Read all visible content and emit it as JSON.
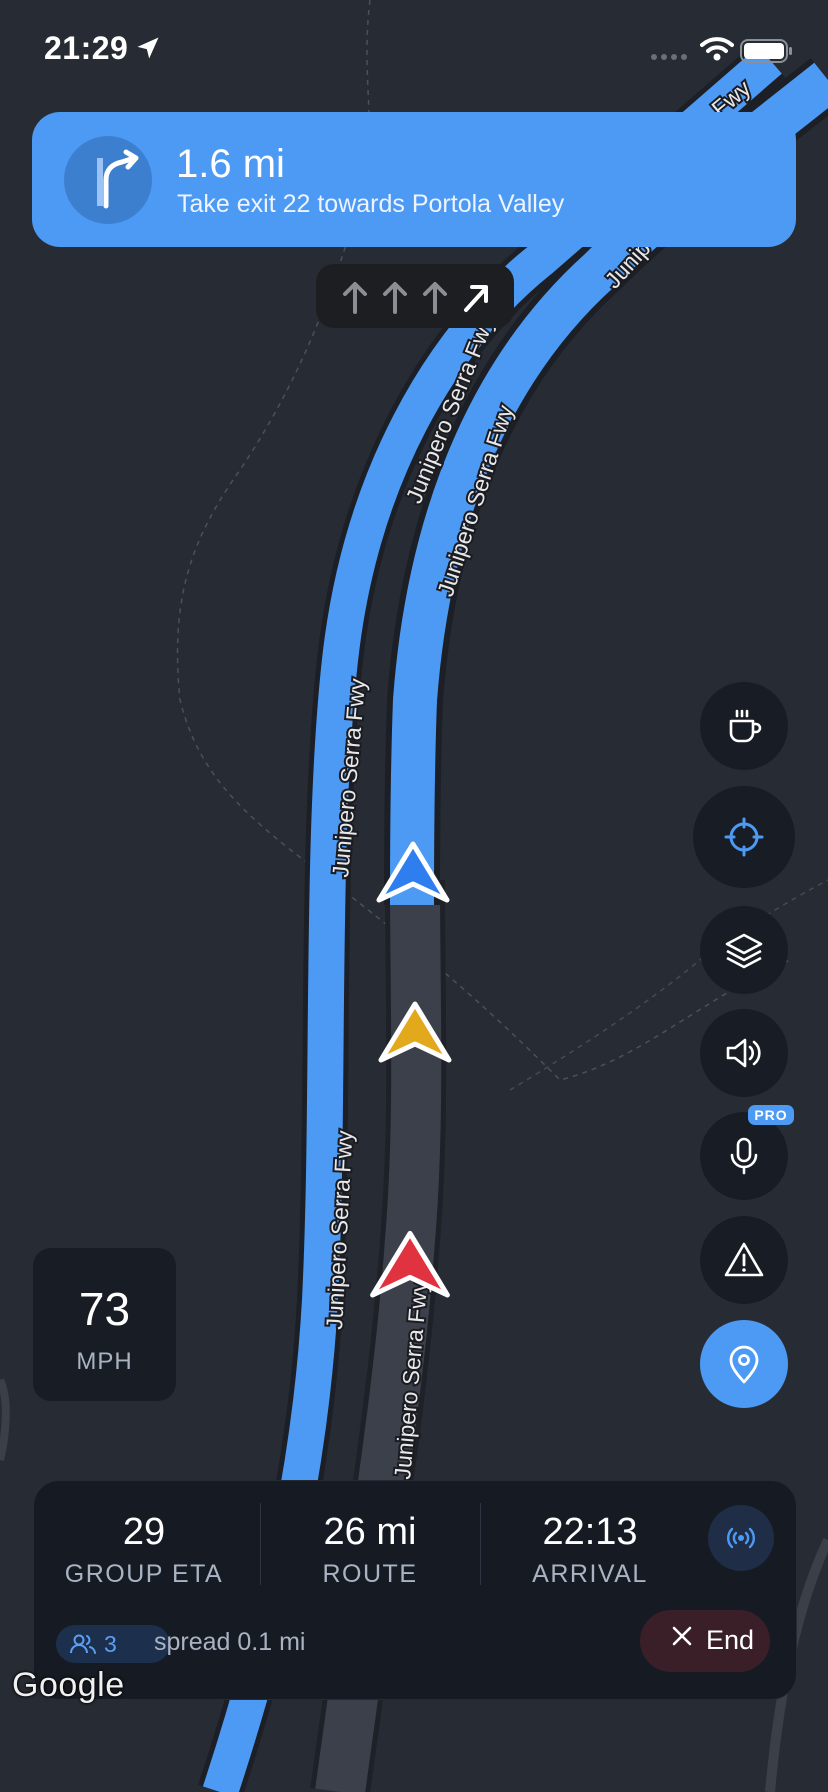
{
  "status_bar": {
    "time": "21:29"
  },
  "navigation": {
    "distance": "1.6 mi",
    "instruction": "Take exit 22 towards Portola Valley",
    "lanes": [
      "straight-arrow-icon",
      "straight-arrow-icon",
      "straight-arrow-icon",
      "slight-right-arrow-icon"
    ],
    "active_lane": 3
  },
  "map": {
    "road_labels": [
      "Junipero Serra Fwy",
      "Junipero Serra Fwy",
      "Junipero Serra Fwy",
      "Junipero Serra Fwy",
      "Junipero Serra Fwy",
      "Junipero Serra Fwy",
      "Fwy",
      "Junip"
    ],
    "markers": [
      {
        "name": "self-position-marker",
        "color": "#2f7ef0"
      },
      {
        "name": "group-member-marker",
        "color": "#e3a91c"
      },
      {
        "name": "group-member-marker",
        "color": "#e0323f"
      }
    ],
    "route_color": "#4d9af5",
    "attribution": "Google"
  },
  "side_buttons": [
    {
      "name": "coffee-stop-button",
      "icon": "coffee-cup-icon"
    },
    {
      "name": "recenter-button",
      "icon": "crosshair-icon"
    },
    {
      "name": "layers-button",
      "icon": "layers-icon"
    },
    {
      "name": "sound-button",
      "icon": "speaker-icon"
    },
    {
      "name": "voice-button",
      "icon": "microphone-icon",
      "badge": "PRO"
    },
    {
      "name": "report-hazard-button",
      "icon": "warning-icon"
    },
    {
      "name": "share-location-button",
      "icon": "location-pin-icon"
    }
  ],
  "speedometer": {
    "value": "73",
    "unit": "MPH"
  },
  "trip": {
    "group_eta": {
      "value": "29",
      "label": "GROUP ETA"
    },
    "route": {
      "value": "26 mi",
      "label": "ROUTE"
    },
    "arrival": {
      "value": "22:13",
      "label": "ARRIVAL"
    },
    "group_count": "3",
    "spread": "spread 0.1 mi",
    "end_label": "End"
  },
  "colors": {
    "accent": "#4d9af5",
    "background": "#272b33",
    "panel": "#161b23"
  }
}
